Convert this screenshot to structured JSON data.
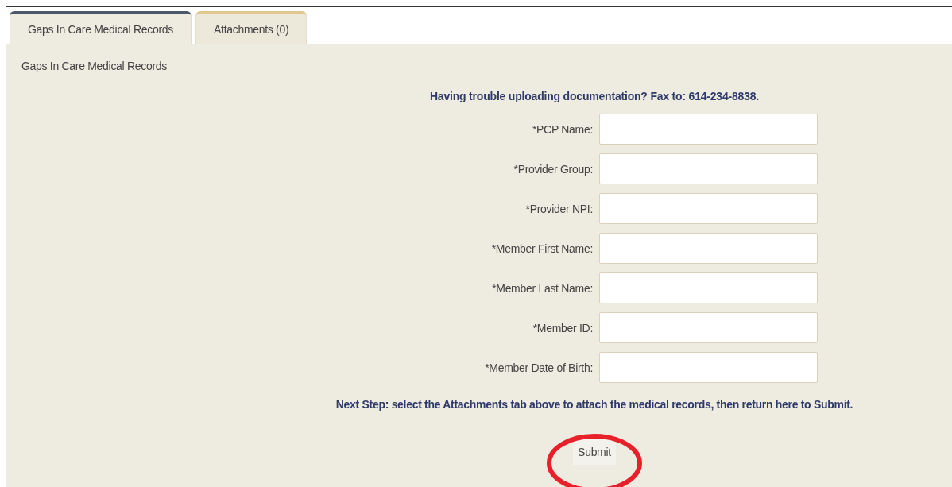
{
  "tabs": [
    {
      "label": "Gaps In Care Medical Records",
      "selected": true
    },
    {
      "label": "Attachments (0)",
      "selected": false
    }
  ],
  "section_title": "Gaps In Care Medical Records",
  "notice": "Having trouble uploading documentation? Fax to: 614-234-8838.",
  "fields": [
    {
      "label": "*PCP Name:"
    },
    {
      "label": "*Provider Group:"
    },
    {
      "label": "*Provider NPI:"
    },
    {
      "label": "*Member First Name:"
    },
    {
      "label": "*Member Last Name:"
    },
    {
      "label": "*Member ID:"
    },
    {
      "label": "*Member Date of Birth:"
    }
  ],
  "next_step": "Next Step: select the Attachments tab above to attach the medical records, then return here to Submit.",
  "submit": {
    "label": "Submit",
    "highlighted": true
  }
}
